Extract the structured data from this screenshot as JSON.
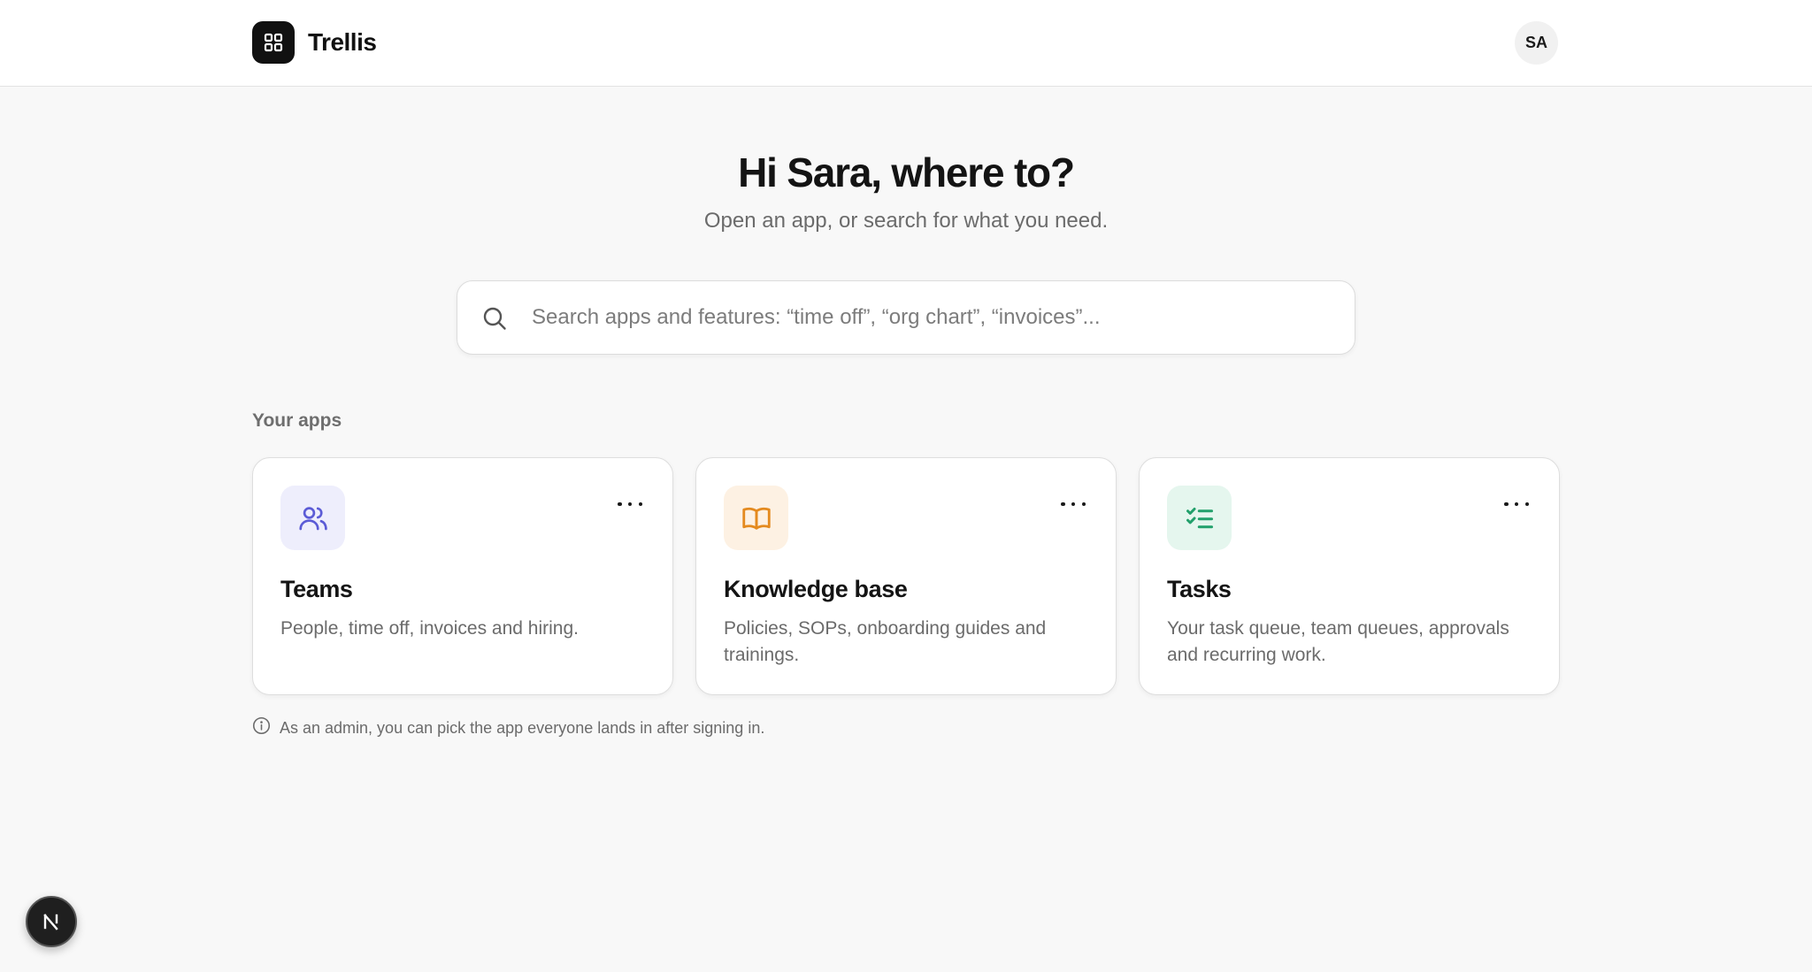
{
  "header": {
    "brand_name": "Trellis",
    "brand_icon": "grid-icon",
    "avatar_initials": "SA"
  },
  "hero": {
    "title": "Hi Sara, where to?",
    "subtitle": "Open an app, or search for what you need."
  },
  "search": {
    "placeholder": "Search apps and features: “time off”, “org chart”, “invoices”...",
    "value": ""
  },
  "apps": {
    "section_label": "Your apps",
    "items": [
      {
        "title": "Teams",
        "description": "People, time off, invoices and hiring.",
        "icon": "users-icon",
        "icon_bg": "#eeeefc",
        "icon_color": "#5b5bd6"
      },
      {
        "title": "Knowledge base",
        "description": "Policies, SOPs, onboarding guides and trainings.",
        "icon": "book-icon",
        "icon_bg": "#fdf1e3",
        "icon_color": "#e48a1f"
      },
      {
        "title": "Tasks",
        "description": "Your task queue, team queues, approvals and recurring work.",
        "icon": "checklist-icon",
        "icon_bg": "#e5f6ee",
        "icon_color": "#22a06b"
      }
    ]
  },
  "note": {
    "text": "As an admin, you can pick the app everyone lands in after signing in."
  },
  "dev_badge": {
    "letter": "N"
  }
}
